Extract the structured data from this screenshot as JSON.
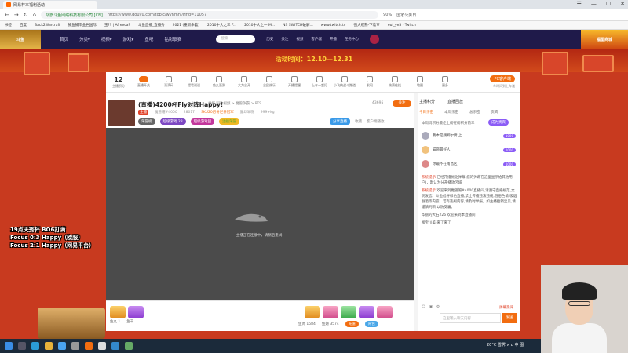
{
  "browser": {
    "tab_title": "网易杯本福利活动",
    "window_buttons": [
      "☰",
      "—",
      "☐",
      "✕"
    ],
    "url_host": "战旗斗鱼网络科技有限公司 [CN]",
    "url_path": "https://www.douyu.com/topic/wynmhl/Hfid=11057",
    "zoom": "90%",
    "search_hint": "国家公务日",
    "bookmarks": [
      "书签",
      "百度",
      "Back2Warcraft",
      "捕鱼捕岸金色国际",
      "玉?? | Afreeca?",
      "斗鱼直播_直播秀",
      "2021 (重新命着)",
      "2010十大之三 F...",
      "2010十大之一 M...",
      "NS SWITCH破解...",
      "www.twitch.tv",
      "强大成熟-下着??",
      "eul_ye3 - Twitch"
    ]
  },
  "site": {
    "logo_text": "斗鱼",
    "nav": [
      "首页",
      "分类▾",
      "视频▾",
      "游戏▾",
      "鱼吧",
      "钻影联赛"
    ],
    "search_placeholder": "搜索",
    "icons": [
      "历史",
      "关注",
      "视频",
      "客户端",
      "开播",
      "任务中心"
    ],
    "badge_text": "福星商城"
  },
  "banner": {
    "title": "活动时间：12.10—12.31"
  },
  "toolbar": {
    "count": "12",
    "count_label": "主播积分",
    "items": [
      "直播开关",
      "滴滴码",
      "提看说说",
      "鱼丸签到",
      "大力全开",
      "全民热乐",
      "开播提醒",
      "上车一起打",
      "小飞侠战斗跑道",
      "发现",
      "热赛住找",
      "地图",
      "更多"
    ],
    "pc_btn": "PC客户端",
    "pc_sub": "车时间到上车道"
  },
  "streamer": {
    "title": "(直播)4200杯Fly对阵Happy!",
    "category": "举报   同款视频  > 魔兽争霸 > RTS",
    "room_id": "43695",
    "follow": "关注",
    "line2": [
      "主播",
      "魔兽帽#4000",
      "28017",
      "SKU20月份世界冠军",
      "魔幻早晚",
      "999+kg"
    ],
    "tags": [
      "荣誉榜",
      "超级游戏 28",
      "超级游戏团",
      "边投荣誉"
    ],
    "right_btns": [
      "分享直播",
      "收藏",
      "客户端播放"
    ]
  },
  "player": {
    "loading_text": "主播正在连接中，请稍后重试"
  },
  "bottom": {
    "fish": [
      "鱼丸 1",
      "鱼干"
    ],
    "fish_right": [
      "鱼丸 1584",
      "鱼翅 3574"
    ],
    "charge": "充值",
    "bag": "背包"
  },
  "chat": {
    "tabs": [
      "主播积分",
      "直播回放"
    ],
    "subtabs": [
      "今日亲密",
      "本周亲密",
      "总亲密",
      "贵宾"
    ],
    "rank_header": "本周周积分最佳上榜在榜积分前三",
    "rank_btn": "成为贵宾",
    "ranks": [
      {
        "name": "我本是朗卿尔姆 上",
        "pill": "1000"
      },
      {
        "name": "猫哥最好人",
        "pill": "1000"
      },
      {
        "name": "你最不在南昌区",
        "pill": "1000"
      }
    ],
    "messages": [
      {
        "sys": "系统提示:",
        "text": "已经开播优化弹幕(您的弹幕在这里显示给其他用户)，默认为分开播放区域"
      },
      {
        "sys": "系统提示:",
        "text": "欢迎来到魔兽帽#4000直播间,请遵守直播规范,文明发言。斗鱼倡导绿色直播,禁止传播违法违规,低俗色情,吸烟酗酒等内容。若有违规内容,请及时举报。如主播推销宝贝,请谨慎判断,以防受骗。"
      },
      {
        "sys": "",
        "text": "华丽的大石226 欢迎来到本直播间"
      },
      {
        "sys": "",
        "text": "富宝川美 来了来了"
      }
    ],
    "input_placeholder": "这里输入聊天内容",
    "send": "发送",
    "hot_label": "弹幕热评",
    "always_label": "发送按钮"
  },
  "overlay": {
    "lines": [
      "19点天秀杯 BO6打满",
      "Focus 0:3 Happy（欧服）",
      "Focus 2:1 Happy（网易平台）"
    ]
  },
  "taskbar": {
    "tray": "20°C 雪霁 ∧ ⌂ 中 图"
  }
}
